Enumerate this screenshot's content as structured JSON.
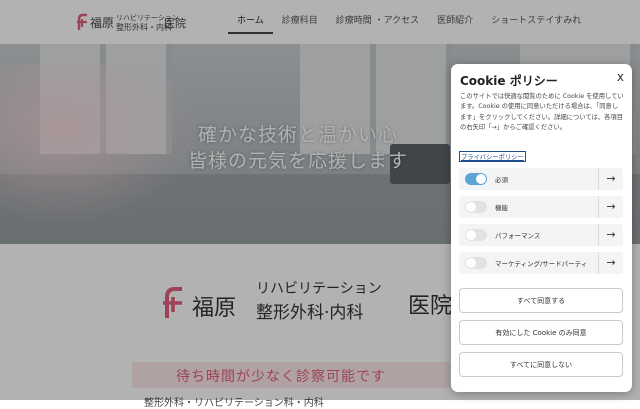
{
  "header": {
    "logo_name": "福原",
    "logo_sub1": "リハビリテーション",
    "logo_sub2": "整形外科・内科",
    "logo_tail": "医院",
    "brand_color": "#e0617a"
  },
  "nav": {
    "items": [
      {
        "label": "ホーム"
      },
      {
        "label": "診療科目"
      },
      {
        "label": "診療時間 ・アクセス"
      },
      {
        "label": "医師紹介"
      },
      {
        "label": "ショートステイすみれ"
      }
    ]
  },
  "hero": {
    "line1": "確かな技術と温かい心",
    "line2": "皆様の元気を応援します"
  },
  "content": {
    "logo_name": "福原",
    "logo_sub1": "リハビリテーション",
    "logo_sub2": "整形外科·内科",
    "logo_tail": "医院",
    "wait_text": "待ち時間が少なく診察可能です",
    "bottom_text": "整形外科・リハビリテーション科・内科"
  },
  "cookie": {
    "title": "Cookie ポリシー",
    "close": "x",
    "description": "このサイトでは快適な閲覧のために Cookie を使用しています。Cookie の使用に同意いただける場合は、「同意します」をクリックしてください。詳細については、各項目の右矢印「→」からご確認ください。",
    "privacy_link": "プライバシーポリシー",
    "categories": [
      {
        "label": "必須",
        "enabled": true
      },
      {
        "label": "機能",
        "enabled": false
      },
      {
        "label": "パフォーマンス",
        "enabled": false
      },
      {
        "label": "マーケティング/サードパーティ",
        "enabled": false
      }
    ],
    "arrow": "→",
    "buttons": {
      "accept_all": "すべて同意する",
      "accept_enabled": "有効にした Cookie のみ同意",
      "reject_all": "すべてに同意しない"
    },
    "toggle_on_color": "#5aa4d8"
  }
}
